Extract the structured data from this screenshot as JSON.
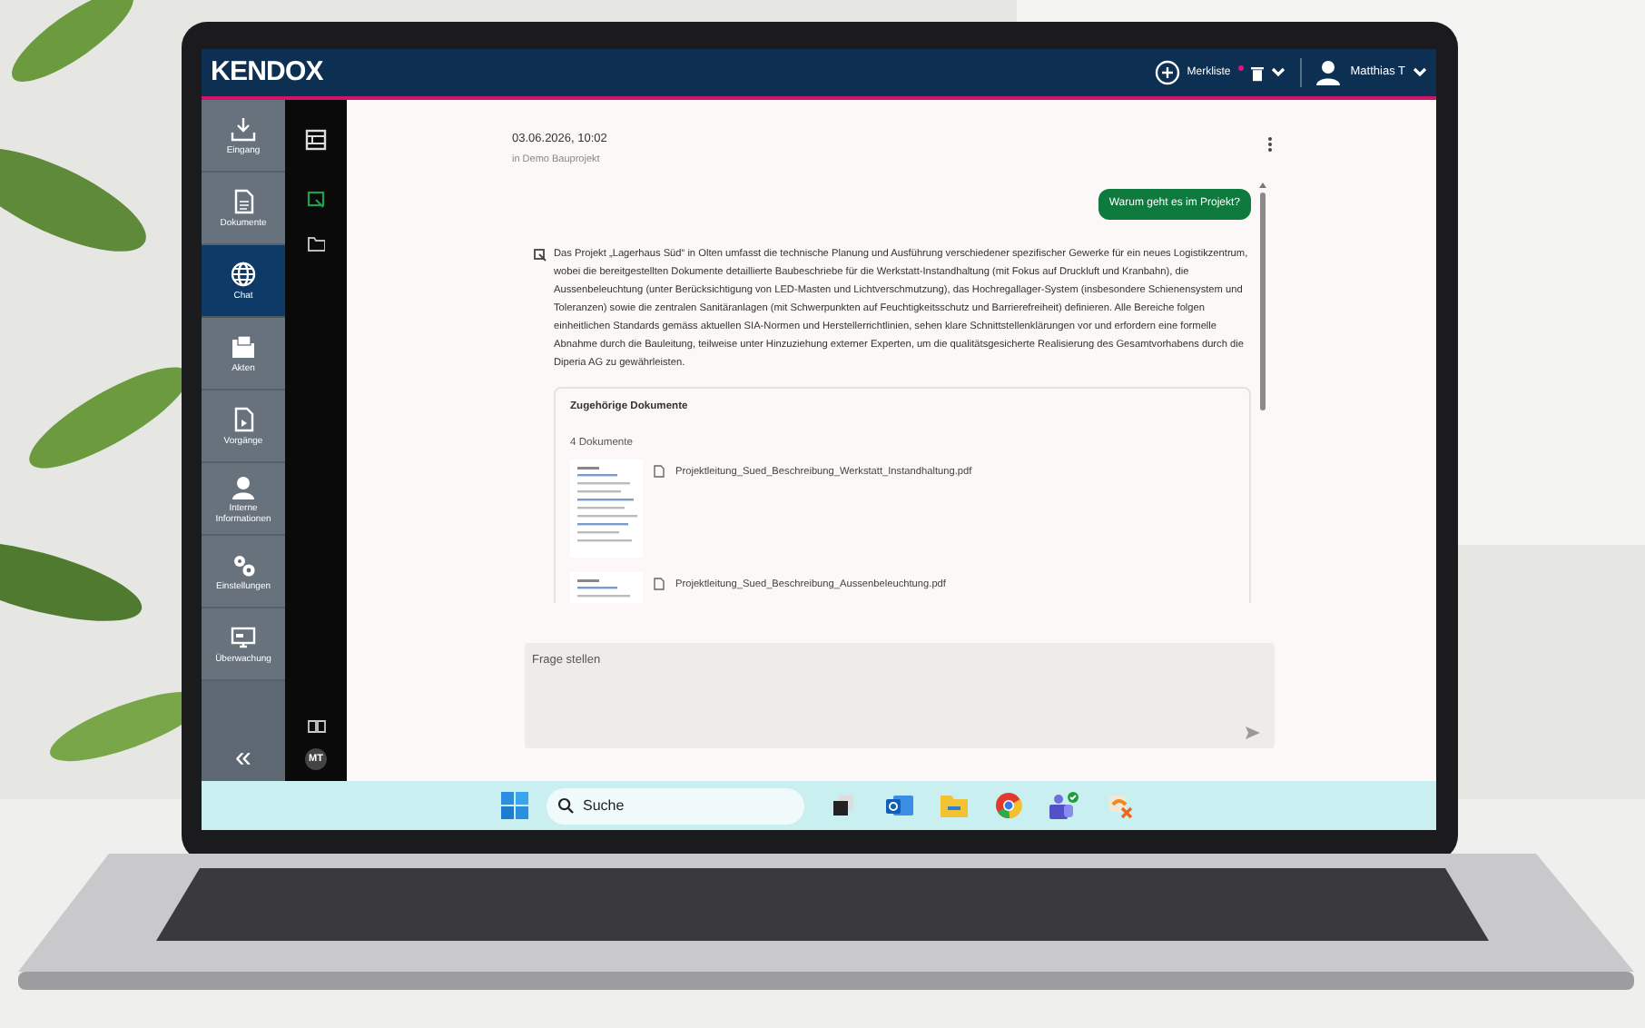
{
  "header": {
    "logo": "KENDOX",
    "bookmark_label": "Merkliste",
    "user_name": "Matthias T"
  },
  "sidebar": {
    "items": [
      {
        "label": "Eingang",
        "selected": false
      },
      {
        "label": "Dokumente",
        "selected": false
      },
      {
        "label": "Chat",
        "selected": true
      },
      {
        "label": "Akten",
        "selected": false
      },
      {
        "label": "Vorgänge",
        "selected": false
      },
      {
        "label": "Interne Informationen",
        "selected": false
      },
      {
        "label": "Einstellungen",
        "selected": false
      },
      {
        "label": "Überwachung",
        "selected": false
      }
    ],
    "collapse": "«"
  },
  "rail": {
    "items": [
      {
        "kind": "chat",
        "selected": true
      },
      {
        "kind": "folder",
        "selected": false
      }
    ],
    "avatar": "MT"
  },
  "chat": {
    "date": "03.06.2026, 10:02",
    "context": "in Demo Bauprojekt",
    "question": "Warum geht es im Projekt?",
    "answer": "Das Projekt „Lagerhaus Süd“ in Olten umfasst die technische Planung und Ausführung verschiedener spezifischer Gewerke für ein neues Logistikzentrum, wobei die bereitgestellten Dokumente detaillierte Baubeschriebe für die Werkstatt-Instandhaltung (mit Fokus auf Druckluft und Kranbahn), die Aussenbeleuchtung (unter Berücksichtigung von LED-Masten und Lichtverschmutzung), das Hochregallager-System (insbesondere Schienensystem und Toleranzen) sowie die zentralen Sanitäranlagen (mit Schwerpunkten auf Feuchtigkeitsschutz und Barrierefreiheit) definieren. Alle Bereiche folgen einheitlichen Standards gemäss aktuellen SIA-Normen und Herstellerrichtlinien, sehen klare Schnittstellenklärungen vor und erfordern eine formelle Abnahme durch die Bauleitung, teilweise unter Hinzuziehung externer Experten, um die qualitätsgesicherte Realisierung des Gesamtvorhabens durch die Diperia AG zu gewährleisten.",
    "related": {
      "title": "Zugehörige Dokumente",
      "count": "4 Dokumente",
      "documents": [
        {
          "name": "Projektleitung_Sued_Beschreibung_Werkstatt_Instandhaltung.pdf"
        },
        {
          "name": "Projektleitung_Sued_Beschreibung_Aussenbeleuchtung.pdf"
        }
      ]
    }
  },
  "input": {
    "placeholder": "Frage stellen"
  },
  "taskbar": {
    "search_placeholder": "Suche"
  }
}
